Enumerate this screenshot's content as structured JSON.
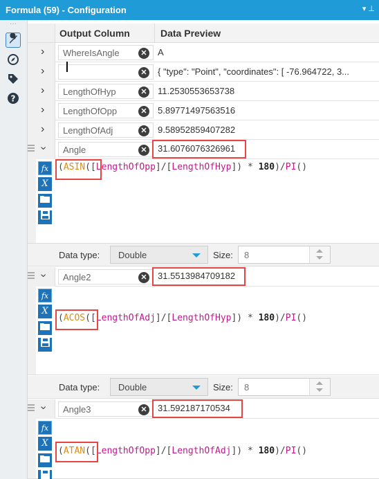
{
  "window": {
    "title": "Formula (59) - Configuration",
    "controls": "▾ ⊥"
  },
  "toolstrip": {
    "icons": [
      "wrench-icon",
      "compass-icon",
      "tag-icon",
      "help-icon"
    ],
    "glyphs": {
      "wrench": "🔧",
      "compass": "◎",
      "tag": "⬤",
      "help": "?"
    }
  },
  "grid": {
    "header_output": "Output Column",
    "header_preview": "Data Preview",
    "rows": [
      {
        "name": "WhereIsAngle",
        "preview": "A"
      },
      {
        "name": "",
        "preview": "{ \"type\": \"Point\", \"coordinates\": [ -76.964722, 3..."
      },
      {
        "name": "LengthOfHyp",
        "preview": "11.2530553653738"
      },
      {
        "name": "LengthOfOpp",
        "preview": "5.89771497563516"
      },
      {
        "name": "LengthOfAdj",
        "preview": "9.58952859407282"
      }
    ]
  },
  "formulas": [
    {
      "name": "Angle",
      "preview": "31.6076076326961",
      "expr": {
        "open": "(",
        "fn": "ASIN",
        "args_open": "([",
        "f1": "LengthOfOpp",
        "div": "]/[",
        "f2": "LengthOfHyp",
        "tail1": "]) * ",
        "num": "180",
        "tail2": ")/",
        "pi": "PI",
        "end": "()"
      },
      "data_type_label": "Data type:",
      "data_type": "Double",
      "size_label": "Size:",
      "size": "8"
    },
    {
      "name": "Angle2",
      "preview": "31.5513984709182",
      "expr": {
        "open": "(",
        "fn": "ACOS",
        "args_open": "([",
        "f1": "LengthOfAdj",
        "div": "]/[",
        "f2": "LengthOfHyp",
        "tail1": "]) * ",
        "num": "180",
        "tail2": ")/",
        "pi": "PI",
        "end": "()"
      },
      "data_type_label": "Data type:",
      "data_type": "Double",
      "size_label": "Size:",
      "size": "8"
    },
    {
      "name": "Angle3",
      "preview": "31.592187170534",
      "expr": {
        "open": "(",
        "fn": "ATAN",
        "args_open": "([",
        "f1": "LengthOfOpp",
        "div": "]/[",
        "f2": "LengthOfAdj",
        "tail1": "]) * ",
        "num": "180",
        "tail2": ")/",
        "pi": "PI",
        "end": "()"
      }
    }
  ],
  "editor_icons": {
    "fx": "fx",
    "var": "X",
    "folder": "▬",
    "save": "▣"
  },
  "colors": {
    "titlebar": "#1f9bd7",
    "highlight": "#e64545",
    "function": "#e08a10",
    "field": "#c2198b",
    "icon_blue": "#1e73b8"
  }
}
